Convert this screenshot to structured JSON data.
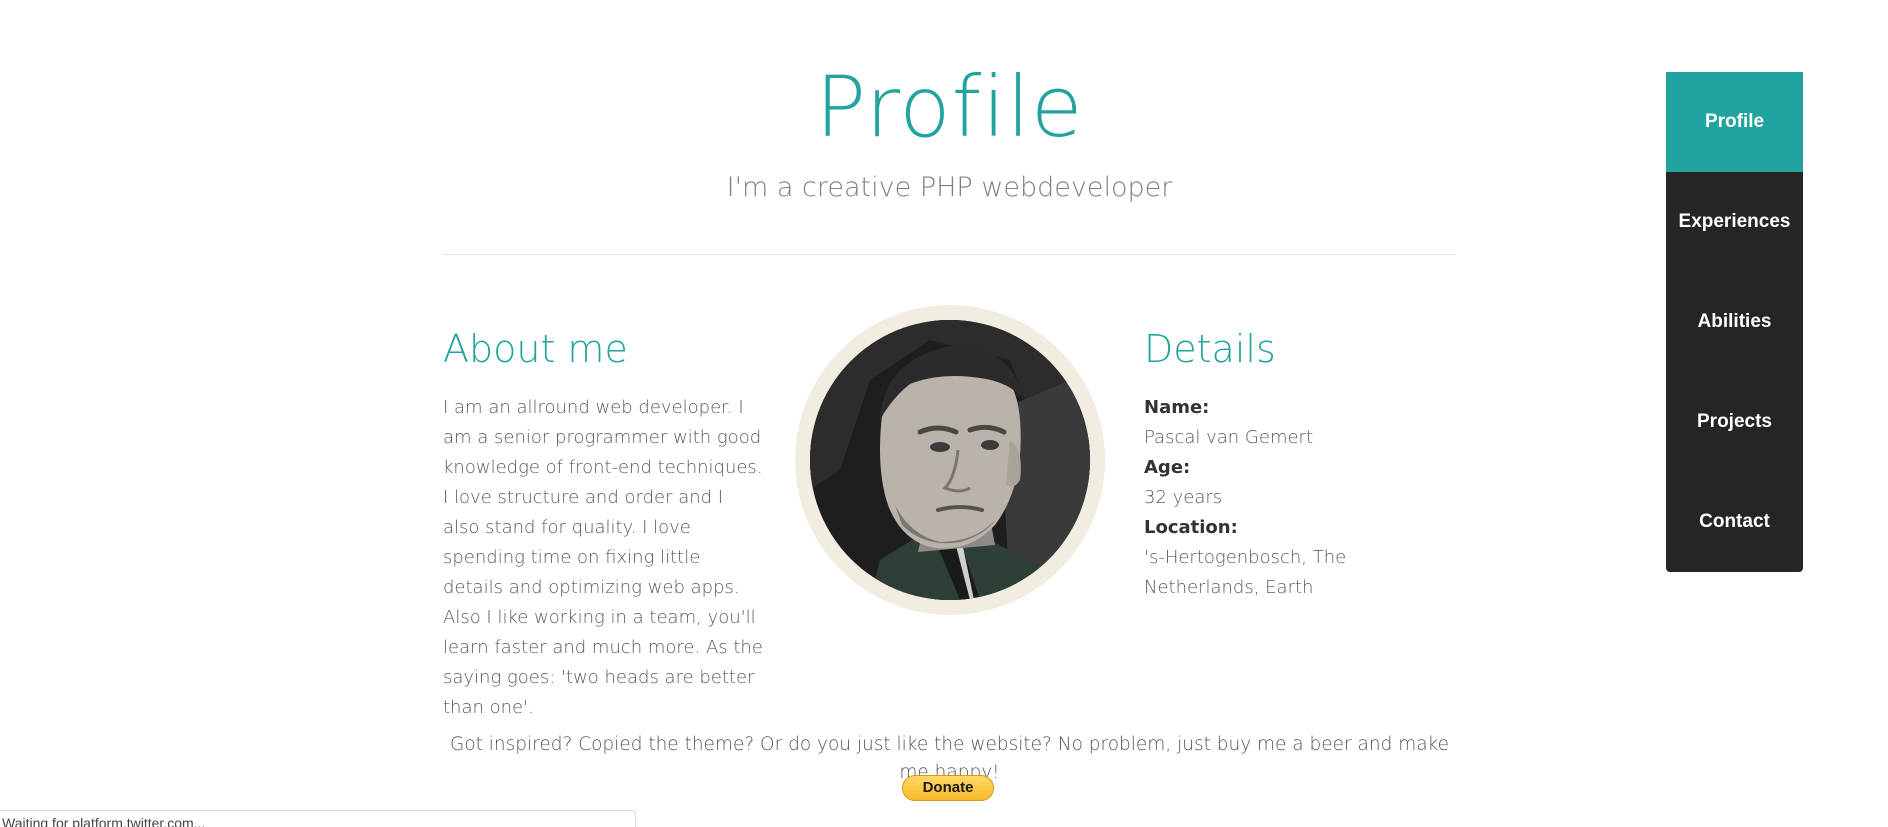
{
  "header": {
    "title": "Profile",
    "subtitle": "I'm a creative PHP webdeveloper"
  },
  "about": {
    "heading": "About me",
    "text": "I am an allround web developer. I am a senior programmer with good knowledge of front-end techniques. I love structure and order and I also stand for quality. I love spending time on fixing little details and optimizing web apps. Also I like working in a team, you'll learn faster and much more. As the saying goes: 'two heads are better than one'."
  },
  "details": {
    "heading": "Details",
    "name_label": "Name:",
    "name_value": "Pascal van Gemert",
    "age_label": "Age:",
    "age_value": "32 years",
    "location_label": "Location:",
    "location_value": "'s-Hertogenbosch, The Netherlands, Earth"
  },
  "donate": {
    "text": "Got inspired? Copied the theme? Or do you just like the website? No problem, just buy me a beer and make me happy!",
    "button_label": "Donate"
  },
  "nav": {
    "items": [
      {
        "label": "Profile",
        "active": true
      },
      {
        "label": "Experiences",
        "active": false
      },
      {
        "label": "Abilities",
        "active": false
      },
      {
        "label": "Projects",
        "active": false
      },
      {
        "label": "Contact",
        "active": false
      }
    ]
  },
  "status_bar": {
    "text": "Waiting for platform.twitter.com..."
  },
  "colors": {
    "accent": "#22a39f",
    "nav_background": "#252525",
    "avatar_ring": "#f1ede1",
    "donate_button": "#f9bb2d"
  }
}
